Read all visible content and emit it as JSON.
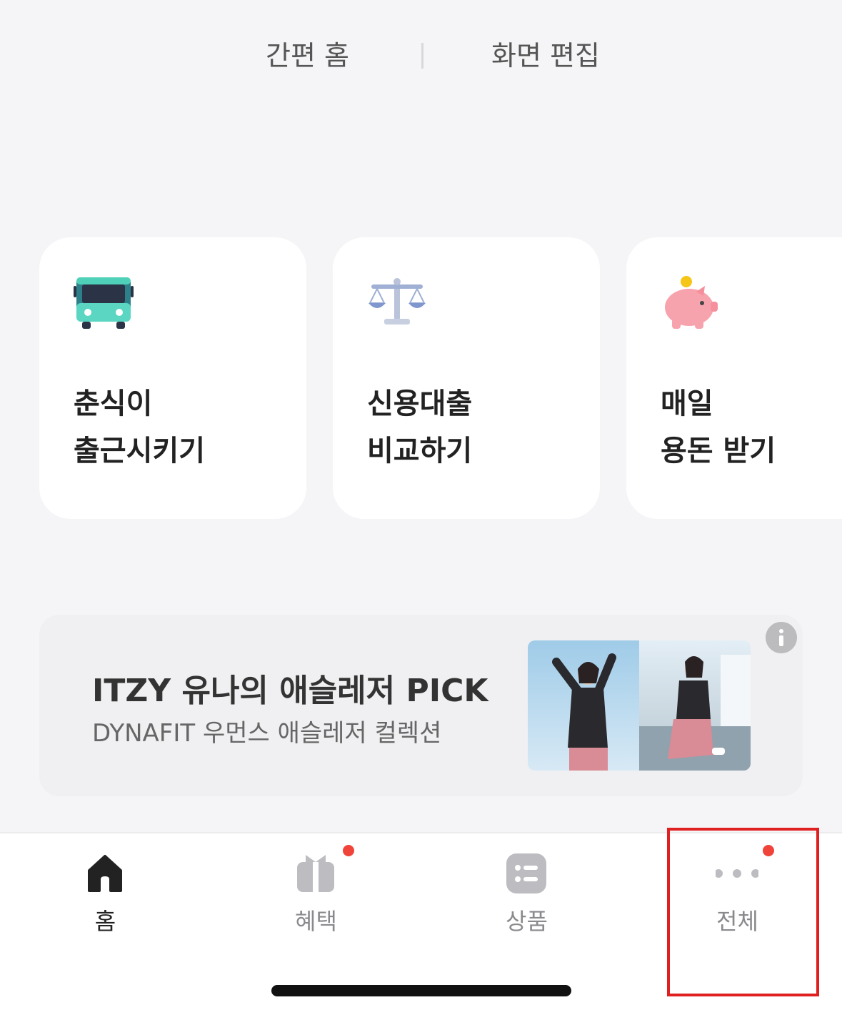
{
  "top": {
    "simple_home": "간편 홈",
    "edit_screen": "화면 편집"
  },
  "cards": [
    {
      "icon": "bus-icon",
      "line1": "춘식이",
      "line2": "출근시키기"
    },
    {
      "icon": "scale-icon",
      "line1": "신용대출",
      "line2": "비교하기"
    },
    {
      "icon": "piggy-bank-icon",
      "line1": "매일",
      "line2": "용돈 받기"
    }
  ],
  "banner": {
    "title": "ITZY 유나의 애슬레저 PICK",
    "subtitle": "DYNAFIT 우먼스 애슬레저 컬렉션",
    "info_icon": "info-icon"
  },
  "tabs": [
    {
      "label": "홈",
      "icon": "home-icon",
      "active": true,
      "badge": false
    },
    {
      "label": "혜택",
      "icon": "gift-icon",
      "active": false,
      "badge": true
    },
    {
      "label": "상품",
      "icon": "list-icon",
      "active": false,
      "badge": false
    },
    {
      "label": "전체",
      "icon": "more-dots-icon",
      "active": false,
      "badge": true
    }
  ],
  "colors": {
    "background": "#f5f5f7",
    "badge": "#f0433a",
    "highlight": "#e02020"
  }
}
